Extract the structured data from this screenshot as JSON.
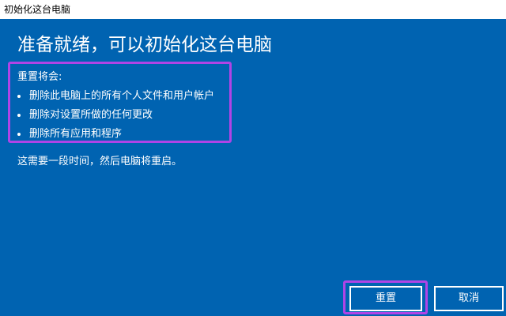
{
  "window": {
    "title": "初始化这台电脑"
  },
  "main": {
    "heading": "准备就绪，可以初始化这台电脑",
    "section_label": "重置将会:",
    "bullets": [
      "删除此电脑上的所有个人文件和用户帐户",
      "删除对设置所做的任何更改",
      "删除所有应用和程序"
    ],
    "info": "这需要一段时间，然后电脑将重启。"
  },
  "buttons": {
    "reset_label": "重置",
    "cancel_label": "取消"
  },
  "colors": {
    "background": "#0063b1",
    "highlight": "#b044e6",
    "text": "#ffffff",
    "titlebar": "#ffffff"
  }
}
